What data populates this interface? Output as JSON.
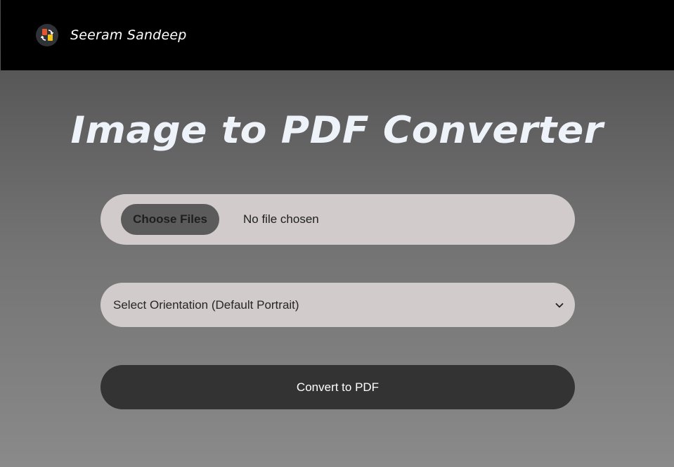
{
  "navbar": {
    "logo_icon": "image-to-pdf-logo-icon",
    "brand_name": "Seeram Sandeep"
  },
  "main": {
    "title": "Image to PDF Converter",
    "file_input": {
      "button_label": "Choose Files",
      "status_text": "No file chosen"
    },
    "orientation_select": {
      "selected": "Select Orientation (Default Portrait)",
      "icon": "chevron-down-icon"
    },
    "convert_button": {
      "label": "Convert to PDF"
    }
  },
  "colors": {
    "navbar_bg": "#000000",
    "input_bg": "#d1cbcb",
    "choose_button_bg": "#5b5b5b",
    "convert_button_bg": "#333333",
    "title_color": "#eef3fa"
  }
}
